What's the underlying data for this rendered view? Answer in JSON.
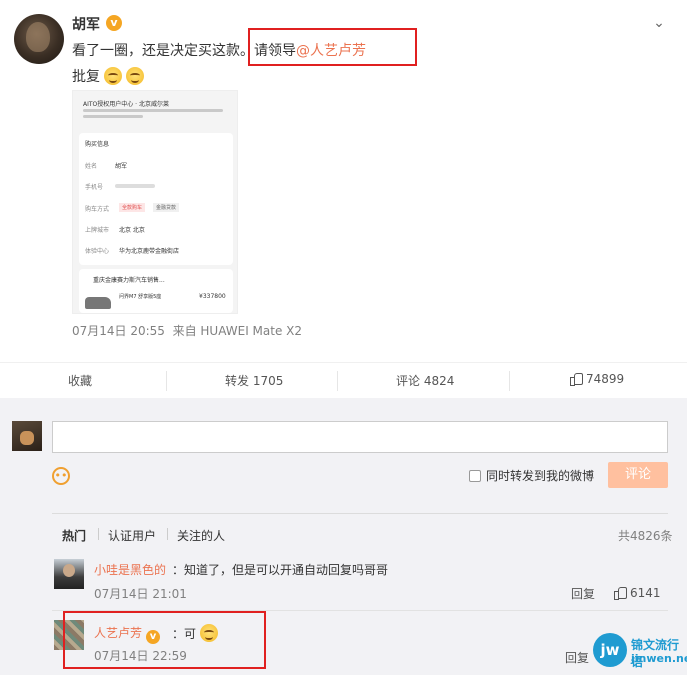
{
  "post": {
    "author": "胡军",
    "text_main": "看了一圈，还是决定买这款。",
    "text_request": "请领导",
    "mention": "@人艺卢芳",
    "text_line2": "批复",
    "image_text": {
      "title": "AITO授权用户中心 · 北京威尔莱",
      "section": "购买信息",
      "name_label": "姓名",
      "name_value": "胡军",
      "phone_label": "手机号",
      "pay_label": "购车方式",
      "pay_opt1": "全款购车",
      "pay_opt2": "金融贷款",
      "city_label": "上牌城市",
      "city_value": "北京 北京",
      "center_label": "体验中心",
      "center_value": "华为北京鹿带金融街店",
      "car_title": "重庆金康赛力斯汽车销售...",
      "car_name": "问界M7 舒享版5座",
      "price": "¥337800"
    },
    "timestamp": "07月14日 20:55",
    "source": "来自 HUAWEI Mate X2"
  },
  "actions": {
    "collect": "收藏",
    "repost": "转发 1705",
    "comment": "评论 4824",
    "like": "74899"
  },
  "composer": {
    "placeholder": "",
    "also_repost": "同时转发到我的微博",
    "submit": "评论"
  },
  "tabs": {
    "hot": "热门",
    "verified": "认证用户",
    "following": "关注的人",
    "total": "共4826条"
  },
  "comments": [
    {
      "name": "小哇是黑色的",
      "text": "：知道了，但是可以开通自动回复吗哥哥",
      "time": "07月14日 21:01",
      "reply": "回复",
      "likes": "6141"
    },
    {
      "name": "人艺卢芳",
      "text": "：可",
      "time": "07月14日 22:59",
      "reply": "回复"
    }
  ],
  "watermark": {
    "logo": "jw",
    "cn": "锦文流行语",
    "en": "jinwen.net"
  },
  "colors": {
    "accent": "#eb7350",
    "verify": "#f5a623",
    "highlight_box": "#e02020"
  }
}
